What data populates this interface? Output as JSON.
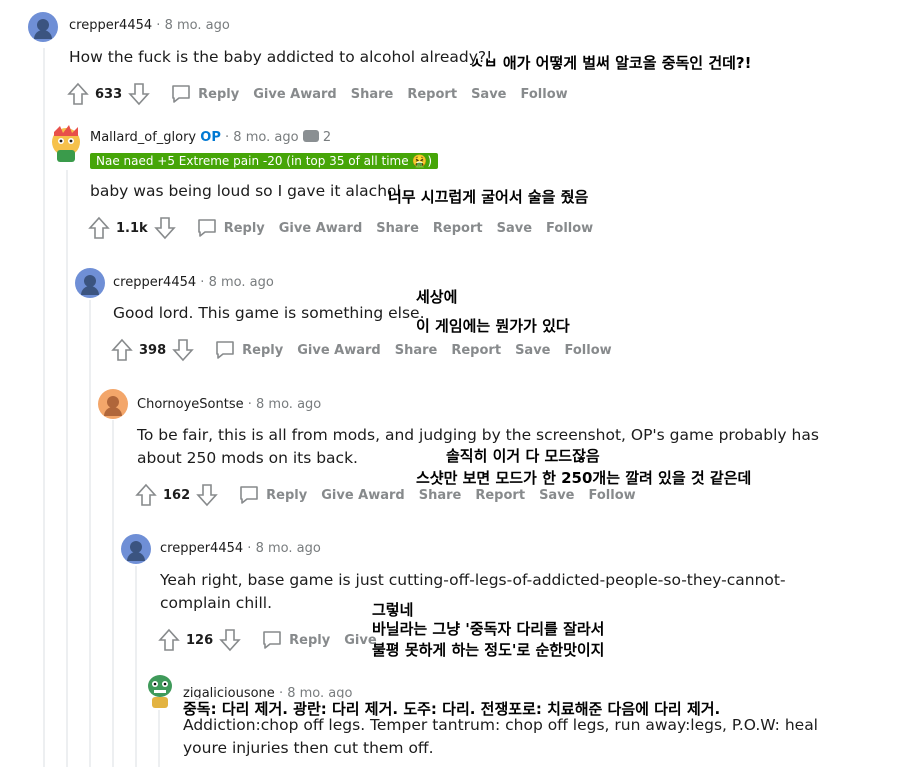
{
  "comments": [
    {
      "user": "crepper4454",
      "time": "8 mo. ago",
      "body": "How the fuck is the baby addicted to alcohol already?!",
      "score": "633",
      "translation": [
        "ㅅㅂ 애가 어떻게 벌써 알코올 중독인 건데?!"
      ]
    },
    {
      "user": "Mallard_of_glory",
      "op": "OP",
      "time": "8 mo. ago",
      "award_count": "2",
      "flair": "Nae naed +5 Extreme pain -20 (in top 35 of all time 🤮)",
      "body": "baby was being loud so I gave it alachol",
      "score": "1.1k",
      "translation": [
        "너무 시끄럽게 굴어서 술을 줬음"
      ]
    },
    {
      "user": "crepper4454",
      "time": "8 mo. ago",
      "body": "Good lord. This game is something else.",
      "score": "398",
      "translation": [
        "세상에",
        "이 게임에는 뭔가가 있다"
      ]
    },
    {
      "user": "ChornoyeSontse",
      "time": "8 mo. ago",
      "body": [
        "To be fair, this is all from mods, and judging by the screenshot, OP's game probably has",
        "about 250 mods on its back."
      ],
      "score": "162",
      "translation": [
        "솔직히 이거 다 모드잖음",
        "스샷만 보면 모드가 한 250개는 깔려 있을 것 같은데"
      ]
    },
    {
      "user": "crepper4454",
      "time": "8 mo. ago",
      "body": [
        "Yeah right, base game is just cutting-off-legs-of-addicted-people-so-they-cannot-",
        "complain chill."
      ],
      "score": "126",
      "partial_action": "Give",
      "translation": [
        "그렇네",
        "바닐라는 그냥 '중독자 다리를 잘라서",
        "불평 못하게 하는 정도'로 순한맛이지"
      ]
    },
    {
      "user": "zigaliciousone",
      "time": "8 mo. ago",
      "body": [
        "Addiction:chop off legs. Temper tantrum: chop off legs, run away:legs, P.O.W: heal",
        "youre injuries then cut them off."
      ],
      "translation": [
        "중독: 다리 제거. 광란: 다리 제거. 도주: 다리. 전쟁포로: 치료해준 다음에 다리 제거."
      ]
    }
  ],
  "actions": {
    "reply": "Reply",
    "give_award": "Give Award",
    "share": "Share",
    "report": "Report",
    "save": "Save",
    "follow": "Follow"
  },
  "separator": "·",
  "colors": {
    "op": "#0079d3",
    "flair": "#46a508",
    "meta": "#787c7e",
    "action": "#878a8c"
  }
}
